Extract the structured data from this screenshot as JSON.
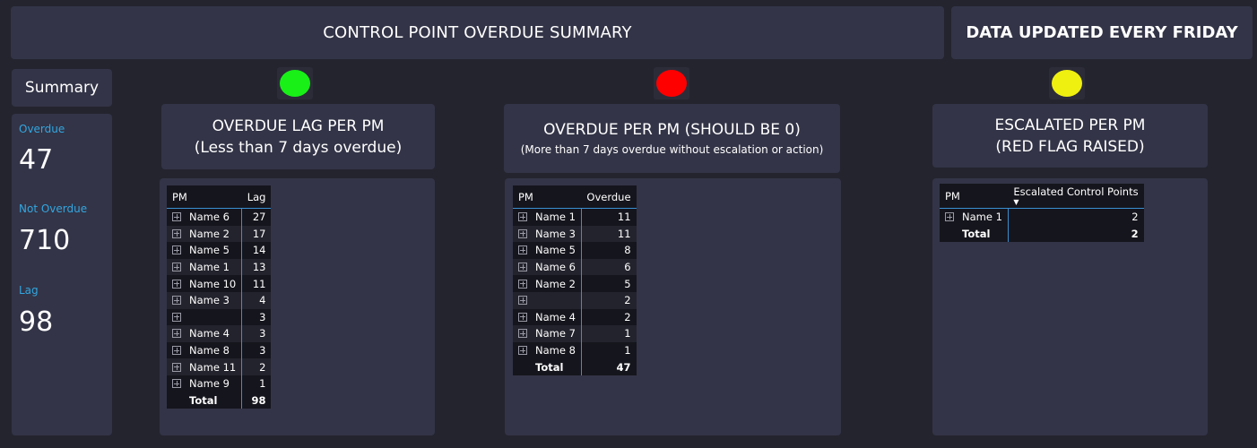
{
  "header": {
    "title": "CONTROL POINT OVERDUE SUMMARY",
    "updated_note": "DATA UPDATED EVERY FRIDAY"
  },
  "summary": {
    "label": "Summary",
    "kpis": [
      {
        "label": "Overdue",
        "value": "47"
      },
      {
        "label": "Not Overdue",
        "value": "710"
      },
      {
        "label": "Lag",
        "value": "98"
      }
    ]
  },
  "colors": {
    "background": "#24242f",
    "panel": "#333447",
    "kpi_label": "#33a6e0",
    "light_green": "#18f018",
    "light_red": "#ff0000",
    "light_yellow": "#f0f010"
  },
  "lag_panel": {
    "status_light": "green",
    "title_line1": "OVERDUE LAG PER PM",
    "title_line2": "(Less than 7 days overdue)",
    "table": {
      "headers": [
        "PM",
        "Lag"
      ],
      "rows": [
        {
          "name": "Name 6",
          "value": "27"
        },
        {
          "name": "Name 2",
          "value": "17"
        },
        {
          "name": "Name 5",
          "value": "14"
        },
        {
          "name": "Name 1",
          "value": "13"
        },
        {
          "name": "Name 10",
          "value": "11"
        },
        {
          "name": "Name 3",
          "value": "4"
        },
        {
          "name": "",
          "value": "3"
        },
        {
          "name": "Name 4",
          "value": "3"
        },
        {
          "name": "Name 8",
          "value": "3"
        },
        {
          "name": "Name 11",
          "value": "2"
        },
        {
          "name": "Name 9",
          "value": "1"
        }
      ],
      "total_label": "Total",
      "total_value": "98"
    }
  },
  "overdue_panel": {
    "status_light": "red",
    "title_line1": "OVERDUE PER PM (SHOULD BE 0)",
    "title_line2": "(More than 7 days overdue without escalation or action)",
    "table": {
      "headers": [
        "PM",
        "Overdue"
      ],
      "rows": [
        {
          "name": "Name 1",
          "value": "11"
        },
        {
          "name": "Name 3",
          "value": "11"
        },
        {
          "name": "Name 5",
          "value": "8"
        },
        {
          "name": "Name 6",
          "value": "6"
        },
        {
          "name": "Name 2",
          "value": "5"
        },
        {
          "name": "",
          "value": "2"
        },
        {
          "name": "Name 4",
          "value": "2"
        },
        {
          "name": "Name 7",
          "value": "1"
        },
        {
          "name": "Name 8",
          "value": "1"
        }
      ],
      "total_label": "Total",
      "total_value": "47"
    }
  },
  "escalated_panel": {
    "status_light": "yellow",
    "title_line1": "ESCALATED PER PM",
    "title_line2": "(RED FLAG RAISED)",
    "table": {
      "headers": [
        "PM",
        "Escalated Control Points"
      ],
      "sort_icon": "sort-descending-icon",
      "rows": [
        {
          "name": "Name 1",
          "value": "2"
        }
      ],
      "total_label": "Total",
      "total_value": "2"
    }
  }
}
